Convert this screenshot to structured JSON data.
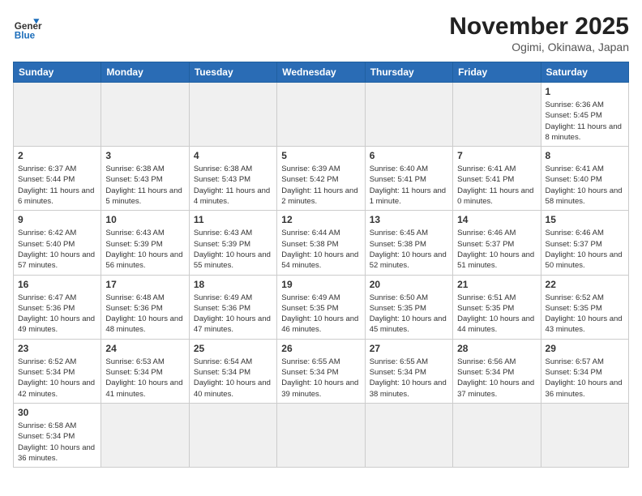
{
  "header": {
    "logo_general": "General",
    "logo_blue": "Blue",
    "month_title": "November 2025",
    "location": "Ogimi, Okinawa, Japan"
  },
  "days_of_week": [
    "Sunday",
    "Monday",
    "Tuesday",
    "Wednesday",
    "Thursday",
    "Friday",
    "Saturday"
  ],
  "weeks": [
    [
      {
        "day": "",
        "empty": true
      },
      {
        "day": "",
        "empty": true
      },
      {
        "day": "",
        "empty": true
      },
      {
        "day": "",
        "empty": true
      },
      {
        "day": "",
        "empty": true
      },
      {
        "day": "",
        "empty": true
      },
      {
        "day": "1",
        "sunrise": "Sunrise: 6:36 AM",
        "sunset": "Sunset: 5:45 PM",
        "daylight": "Daylight: 11 hours and 8 minutes."
      }
    ],
    [
      {
        "day": "2",
        "sunrise": "Sunrise: 6:37 AM",
        "sunset": "Sunset: 5:44 PM",
        "daylight": "Daylight: 11 hours and 6 minutes."
      },
      {
        "day": "3",
        "sunrise": "Sunrise: 6:38 AM",
        "sunset": "Sunset: 5:43 PM",
        "daylight": "Daylight: 11 hours and 5 minutes."
      },
      {
        "day": "4",
        "sunrise": "Sunrise: 6:38 AM",
        "sunset": "Sunset: 5:43 PM",
        "daylight": "Daylight: 11 hours and 4 minutes."
      },
      {
        "day": "5",
        "sunrise": "Sunrise: 6:39 AM",
        "sunset": "Sunset: 5:42 PM",
        "daylight": "Daylight: 11 hours and 2 minutes."
      },
      {
        "day": "6",
        "sunrise": "Sunrise: 6:40 AM",
        "sunset": "Sunset: 5:41 PM",
        "daylight": "Daylight: 11 hours and 1 minute."
      },
      {
        "day": "7",
        "sunrise": "Sunrise: 6:41 AM",
        "sunset": "Sunset: 5:41 PM",
        "daylight": "Daylight: 11 hours and 0 minutes."
      },
      {
        "day": "8",
        "sunrise": "Sunrise: 6:41 AM",
        "sunset": "Sunset: 5:40 PM",
        "daylight": "Daylight: 10 hours and 58 minutes."
      }
    ],
    [
      {
        "day": "9",
        "sunrise": "Sunrise: 6:42 AM",
        "sunset": "Sunset: 5:40 PM",
        "daylight": "Daylight: 10 hours and 57 minutes."
      },
      {
        "day": "10",
        "sunrise": "Sunrise: 6:43 AM",
        "sunset": "Sunset: 5:39 PM",
        "daylight": "Daylight: 10 hours and 56 minutes."
      },
      {
        "day": "11",
        "sunrise": "Sunrise: 6:43 AM",
        "sunset": "Sunset: 5:39 PM",
        "daylight": "Daylight: 10 hours and 55 minutes."
      },
      {
        "day": "12",
        "sunrise": "Sunrise: 6:44 AM",
        "sunset": "Sunset: 5:38 PM",
        "daylight": "Daylight: 10 hours and 54 minutes."
      },
      {
        "day": "13",
        "sunrise": "Sunrise: 6:45 AM",
        "sunset": "Sunset: 5:38 PM",
        "daylight": "Daylight: 10 hours and 52 minutes."
      },
      {
        "day": "14",
        "sunrise": "Sunrise: 6:46 AM",
        "sunset": "Sunset: 5:37 PM",
        "daylight": "Daylight: 10 hours and 51 minutes."
      },
      {
        "day": "15",
        "sunrise": "Sunrise: 6:46 AM",
        "sunset": "Sunset: 5:37 PM",
        "daylight": "Daylight: 10 hours and 50 minutes."
      }
    ],
    [
      {
        "day": "16",
        "sunrise": "Sunrise: 6:47 AM",
        "sunset": "Sunset: 5:36 PM",
        "daylight": "Daylight: 10 hours and 49 minutes."
      },
      {
        "day": "17",
        "sunrise": "Sunrise: 6:48 AM",
        "sunset": "Sunset: 5:36 PM",
        "daylight": "Daylight: 10 hours and 48 minutes."
      },
      {
        "day": "18",
        "sunrise": "Sunrise: 6:49 AM",
        "sunset": "Sunset: 5:36 PM",
        "daylight": "Daylight: 10 hours and 47 minutes."
      },
      {
        "day": "19",
        "sunrise": "Sunrise: 6:49 AM",
        "sunset": "Sunset: 5:35 PM",
        "daylight": "Daylight: 10 hours and 46 minutes."
      },
      {
        "day": "20",
        "sunrise": "Sunrise: 6:50 AM",
        "sunset": "Sunset: 5:35 PM",
        "daylight": "Daylight: 10 hours and 45 minutes."
      },
      {
        "day": "21",
        "sunrise": "Sunrise: 6:51 AM",
        "sunset": "Sunset: 5:35 PM",
        "daylight": "Daylight: 10 hours and 44 minutes."
      },
      {
        "day": "22",
        "sunrise": "Sunrise: 6:52 AM",
        "sunset": "Sunset: 5:35 PM",
        "daylight": "Daylight: 10 hours and 43 minutes."
      }
    ],
    [
      {
        "day": "23",
        "sunrise": "Sunrise: 6:52 AM",
        "sunset": "Sunset: 5:34 PM",
        "daylight": "Daylight: 10 hours and 42 minutes."
      },
      {
        "day": "24",
        "sunrise": "Sunrise: 6:53 AM",
        "sunset": "Sunset: 5:34 PM",
        "daylight": "Daylight: 10 hours and 41 minutes."
      },
      {
        "day": "25",
        "sunrise": "Sunrise: 6:54 AM",
        "sunset": "Sunset: 5:34 PM",
        "daylight": "Daylight: 10 hours and 40 minutes."
      },
      {
        "day": "26",
        "sunrise": "Sunrise: 6:55 AM",
        "sunset": "Sunset: 5:34 PM",
        "daylight": "Daylight: 10 hours and 39 minutes."
      },
      {
        "day": "27",
        "sunrise": "Sunrise: 6:55 AM",
        "sunset": "Sunset: 5:34 PM",
        "daylight": "Daylight: 10 hours and 38 minutes."
      },
      {
        "day": "28",
        "sunrise": "Sunrise: 6:56 AM",
        "sunset": "Sunset: 5:34 PM",
        "daylight": "Daylight: 10 hours and 37 minutes."
      },
      {
        "day": "29",
        "sunrise": "Sunrise: 6:57 AM",
        "sunset": "Sunset: 5:34 PM",
        "daylight": "Daylight: 10 hours and 36 minutes."
      }
    ],
    [
      {
        "day": "30",
        "sunrise": "Sunrise: 6:58 AM",
        "sunset": "Sunset: 5:34 PM",
        "daylight": "Daylight: 10 hours and 36 minutes."
      },
      {
        "day": "",
        "empty": true
      },
      {
        "day": "",
        "empty": true
      },
      {
        "day": "",
        "empty": true
      },
      {
        "day": "",
        "empty": true
      },
      {
        "day": "",
        "empty": true
      },
      {
        "day": "",
        "empty": true
      }
    ]
  ]
}
